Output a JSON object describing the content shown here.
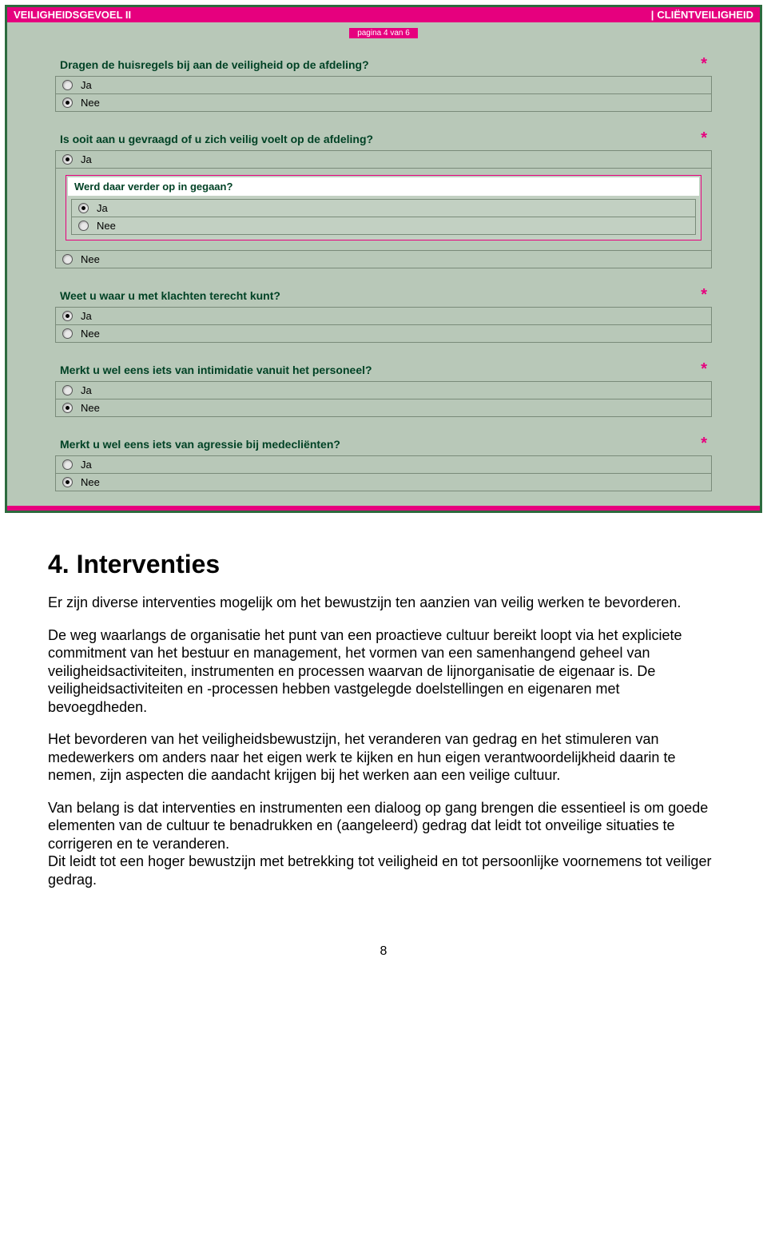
{
  "header": {
    "title_caps": "V",
    "title_rest": "EILIGHEIDSGEVOEL",
    "roman": "II",
    "right_sep": "|",
    "right_caps": "C",
    "right_rest": "LIËNTVEILIGHEID"
  },
  "pager": "pagina 4 van 6",
  "options": {
    "yes": "Ja",
    "no": "Nee"
  },
  "required_mark": "*",
  "questions": [
    {
      "id": "q1",
      "label": "Dragen de huisregels bij aan de veiligheid op de afdeling?",
      "selected": "no"
    },
    {
      "id": "q2",
      "label": "Is ooit aan u gevraagd of u zich veilig voelt op de afdeling?",
      "selected": "yes",
      "nested": {
        "label": "Werd daar verder op in gegaan?",
        "selected": "yes"
      }
    },
    {
      "id": "q3",
      "label": "Weet u waar u met klachten terecht kunt?",
      "selected": "yes"
    },
    {
      "id": "q4",
      "label": "Merkt u wel eens iets van intimidatie vanuit het personeel?",
      "selected": "no"
    },
    {
      "id": "q5",
      "label": "Merkt u wel eens iets van agressie bij medecliënten?",
      "selected": "no"
    }
  ],
  "doc": {
    "heading": "4. Interventies",
    "p1": "Er zijn diverse interventies mogelijk om het bewustzijn ten aanzien van veilig werken te bevorderen.",
    "p2": "De weg waarlangs de organisatie het punt van een proactieve cultuur bereikt loopt via het expliciete commitment van het bestuur en management, het vormen van een samenhangend geheel van veiligheidsactiviteiten, instrumenten en processen waarvan de lijnorganisatie de eigenaar is. De veiligheidsactiviteiten en -processen hebben vastgelegde doelstellingen en eigenaren met bevoegdheden.",
    "p3": "Het bevorderen van het veiligheidsbewustzijn, het veranderen van gedrag en het stimuleren van medewerkers om anders naar het eigen werk te kijken en hun eigen verantwoordelijkheid daarin te nemen, zijn aspecten die aandacht krijgen bij het werken aan een veilige cultuur.",
    "p4": "Van belang is dat interventies en instrumenten een dialoog op gang brengen die essentieel is om goede elementen van de cultuur te benadrukken en (aangeleerd) gedrag dat leidt tot onveilige situaties te corrigeren en te veranderen.",
    "p5": "Dit leidt tot een hoger bewustzijn met betrekking tot veiligheid en tot persoonlijke voornemens tot veiliger gedrag.",
    "page_number": "8"
  }
}
